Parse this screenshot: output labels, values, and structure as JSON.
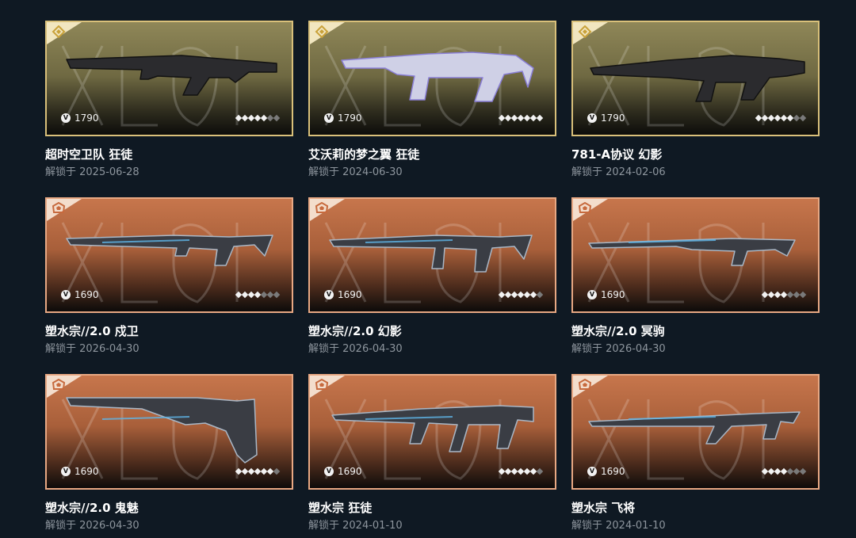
{
  "cards": [
    {
      "name": "超时空卫队 狂徒",
      "unlock": "解锁于 2025-06-28",
      "price": "1790",
      "tier": "gold",
      "stars_filled": 5,
      "stars_total": 7,
      "icon": "exclusive-tier-icon"
    },
    {
      "name": "艾沃莉的梦之翼 狂徒",
      "unlock": "解锁于 2024-06-30",
      "price": "1790",
      "tier": "gold",
      "stars_filled": 7,
      "stars_total": 7,
      "icon": "exclusive-tier-icon"
    },
    {
      "name": "781-A协议 幻影",
      "unlock": "解锁于 2024-02-06",
      "price": "1790",
      "tier": "gold",
      "stars_filled": 6,
      "stars_total": 8,
      "icon": "exclusive-tier-icon"
    },
    {
      "name": "塑水宗//2.0 戍卫",
      "unlock": "解锁于 2026-04-30",
      "price": "1690",
      "tier": "orange",
      "stars_filled": 4,
      "stars_total": 7,
      "icon": "premium-tier-icon"
    },
    {
      "name": "塑水宗//2.0 幻影",
      "unlock": "解锁于 2026-04-30",
      "price": "1690",
      "tier": "orange",
      "stars_filled": 6,
      "stars_total": 7,
      "icon": "premium-tier-icon"
    },
    {
      "name": "塑水宗//2.0 冥驹",
      "unlock": "解锁于 2026-04-30",
      "price": "1690",
      "tier": "orange",
      "stars_filled": 4,
      "stars_total": 7,
      "icon": "premium-tier-icon"
    },
    {
      "name": "塑水宗//2.0 鬼魅",
      "unlock": "解锁于 2026-04-30",
      "price": "1690",
      "tier": "orange",
      "stars_filled": 6,
      "stars_total": 7,
      "icon": "premium-tier-icon"
    },
    {
      "name": "塑水宗 狂徒",
      "unlock": "解锁于 2024-01-10",
      "price": "1690",
      "tier": "orange",
      "stars_filled": 6,
      "stars_total": 7,
      "icon": "premium-tier-icon"
    },
    {
      "name": "塑水宗 飞将",
      "unlock": "解锁于 2024-01-10",
      "price": "1690",
      "tier": "orange",
      "stars_filled": 4,
      "stars_total": 7,
      "icon": "premium-tier-icon"
    }
  ],
  "currency_icon": "valorant-points-icon",
  "currency_glyph": "V",
  "colors": {
    "background": "#0f1923",
    "gold_border": "#d9c07a",
    "orange_border": "#e8a883",
    "name_text": "#ffffff",
    "date_text": "#8d959d"
  }
}
